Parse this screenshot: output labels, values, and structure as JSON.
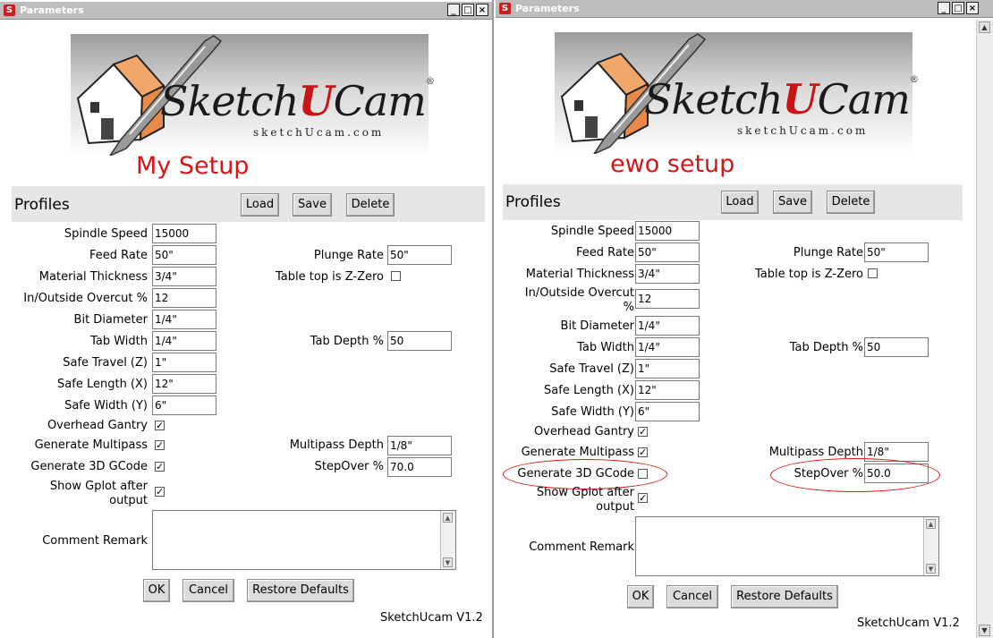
{
  "left": {
    "title": "Parameters",
    "setup_label": "My Setup",
    "logo": {
      "brand_pre": "Sketch",
      "brand_u": "U",
      "brand_post": "Cam",
      "reg": "®",
      "subtitle": "sketchUcam.com"
    },
    "profiles": {
      "label": "Profiles",
      "load": "Load",
      "save": "Save",
      "delete": "Delete"
    },
    "fields": {
      "spindle_speed": {
        "label": "Spindle Speed",
        "value": "15000"
      },
      "feed_rate": {
        "label": "Feed Rate",
        "value": "50\""
      },
      "plunge_rate": {
        "label": "Plunge Rate",
        "value": "50\""
      },
      "material_thickness": {
        "label": "Material Thickness",
        "value": "3/4\""
      },
      "table_top": {
        "label": "Table top is Z-Zero",
        "checked": false
      },
      "overcut": {
        "label": "In/Outside Overcut %",
        "value": "12"
      },
      "bit_diameter": {
        "label": "Bit Diameter",
        "value": "1/4\""
      },
      "tab_width": {
        "label": "Tab Width",
        "value": "1/4\""
      },
      "tab_depth": {
        "label": "Tab Depth %",
        "value": "50"
      },
      "safe_travel": {
        "label": "Safe Travel (Z)",
        "value": "1\""
      },
      "safe_length": {
        "label": "Safe Length (X)",
        "value": "12\""
      },
      "safe_width": {
        "label": "Safe Width (Y)",
        "value": "6\""
      },
      "overhead_gantry": {
        "label": "Overhead Gantry",
        "checked": true
      },
      "generate_multipass": {
        "label": "Generate Multipass",
        "checked": true
      },
      "multipass_depth": {
        "label": "Multipass Depth",
        "value": "1/8\""
      },
      "generate_3d": {
        "label": "Generate 3D GCode",
        "checked": true
      },
      "stepover": {
        "label": "StepOver %",
        "value": "70.0"
      },
      "show_gplot_1": "Show Gplot after",
      "show_gplot_2": "output",
      "show_gplot_checked": true,
      "comment": {
        "label": "Comment Remark",
        "value": ""
      }
    },
    "buttons": {
      "ok": "OK",
      "cancel": "Cancel",
      "restore": "Restore Defaults"
    },
    "version": "SketchUcam V1.2"
  },
  "right": {
    "title": "Parameters",
    "setup_label": "ewo setup",
    "logo": {
      "brand_pre": "Sketch",
      "brand_u": "U",
      "brand_post": "Cam",
      "reg": "®",
      "subtitle": "sketchUcam.com"
    },
    "profiles": {
      "label": "Profiles",
      "load": "Load",
      "save": "Save",
      "delete": "Delete"
    },
    "fields": {
      "spindle_speed": {
        "label": "Spindle Speed",
        "value": "15000"
      },
      "feed_rate": {
        "label": "Feed Rate",
        "value": "50\""
      },
      "plunge_rate": {
        "label": "Plunge Rate",
        "value": "50\""
      },
      "material_thickness": {
        "label": "Material Thickness",
        "value": "3/4\""
      },
      "table_top": {
        "label": "Table top is Z-Zero",
        "checked": false
      },
      "overcut_1": "In/Outside Overcut",
      "overcut_2": "%",
      "overcut_value": "12",
      "bit_diameter": {
        "label": "Bit Diameter",
        "value": "1/4\""
      },
      "tab_width": {
        "label": "Tab Width",
        "value": "1/4\""
      },
      "tab_depth": {
        "label": "Tab Depth %",
        "value": "50"
      },
      "safe_travel": {
        "label": "Safe Travel (Z)",
        "value": "1\""
      },
      "safe_length": {
        "label": "Safe Length (X)",
        "value": "12\""
      },
      "safe_width": {
        "label": "Safe Width (Y)",
        "value": "6\""
      },
      "overhead_gantry": {
        "label": "Overhead Gantry",
        "checked": true
      },
      "generate_multipass": {
        "label": "Generate Multipass",
        "checked": true
      },
      "multipass_depth": {
        "label": "Multipass Depth",
        "value": "1/8\""
      },
      "generate_3d": {
        "label": "Generate 3D GCode",
        "checked": false
      },
      "stepover": {
        "label": "StepOver %",
        "value": "50.0"
      },
      "show_gplot_1": "Show Gplot after",
      "show_gplot_2": "output",
      "show_gplot_checked": true,
      "comment": {
        "label": "Comment Remark",
        "value": ""
      }
    },
    "buttons": {
      "ok": "OK",
      "cancel": "Cancel",
      "restore": "Restore Defaults"
    },
    "version": "SketchUcam V1.2"
  },
  "window_controls": {
    "minimize": "_",
    "maximize": "□",
    "close": "×"
  },
  "colors": {
    "setup_label": "#d01818",
    "annotation": "#dd1111",
    "brand_u": "#c81616"
  },
  "icons": [
    "sketchup-app-icon",
    "house-logo-icon",
    "drill-bit-icon",
    "scroll-up-icon",
    "scroll-down-icon"
  ]
}
